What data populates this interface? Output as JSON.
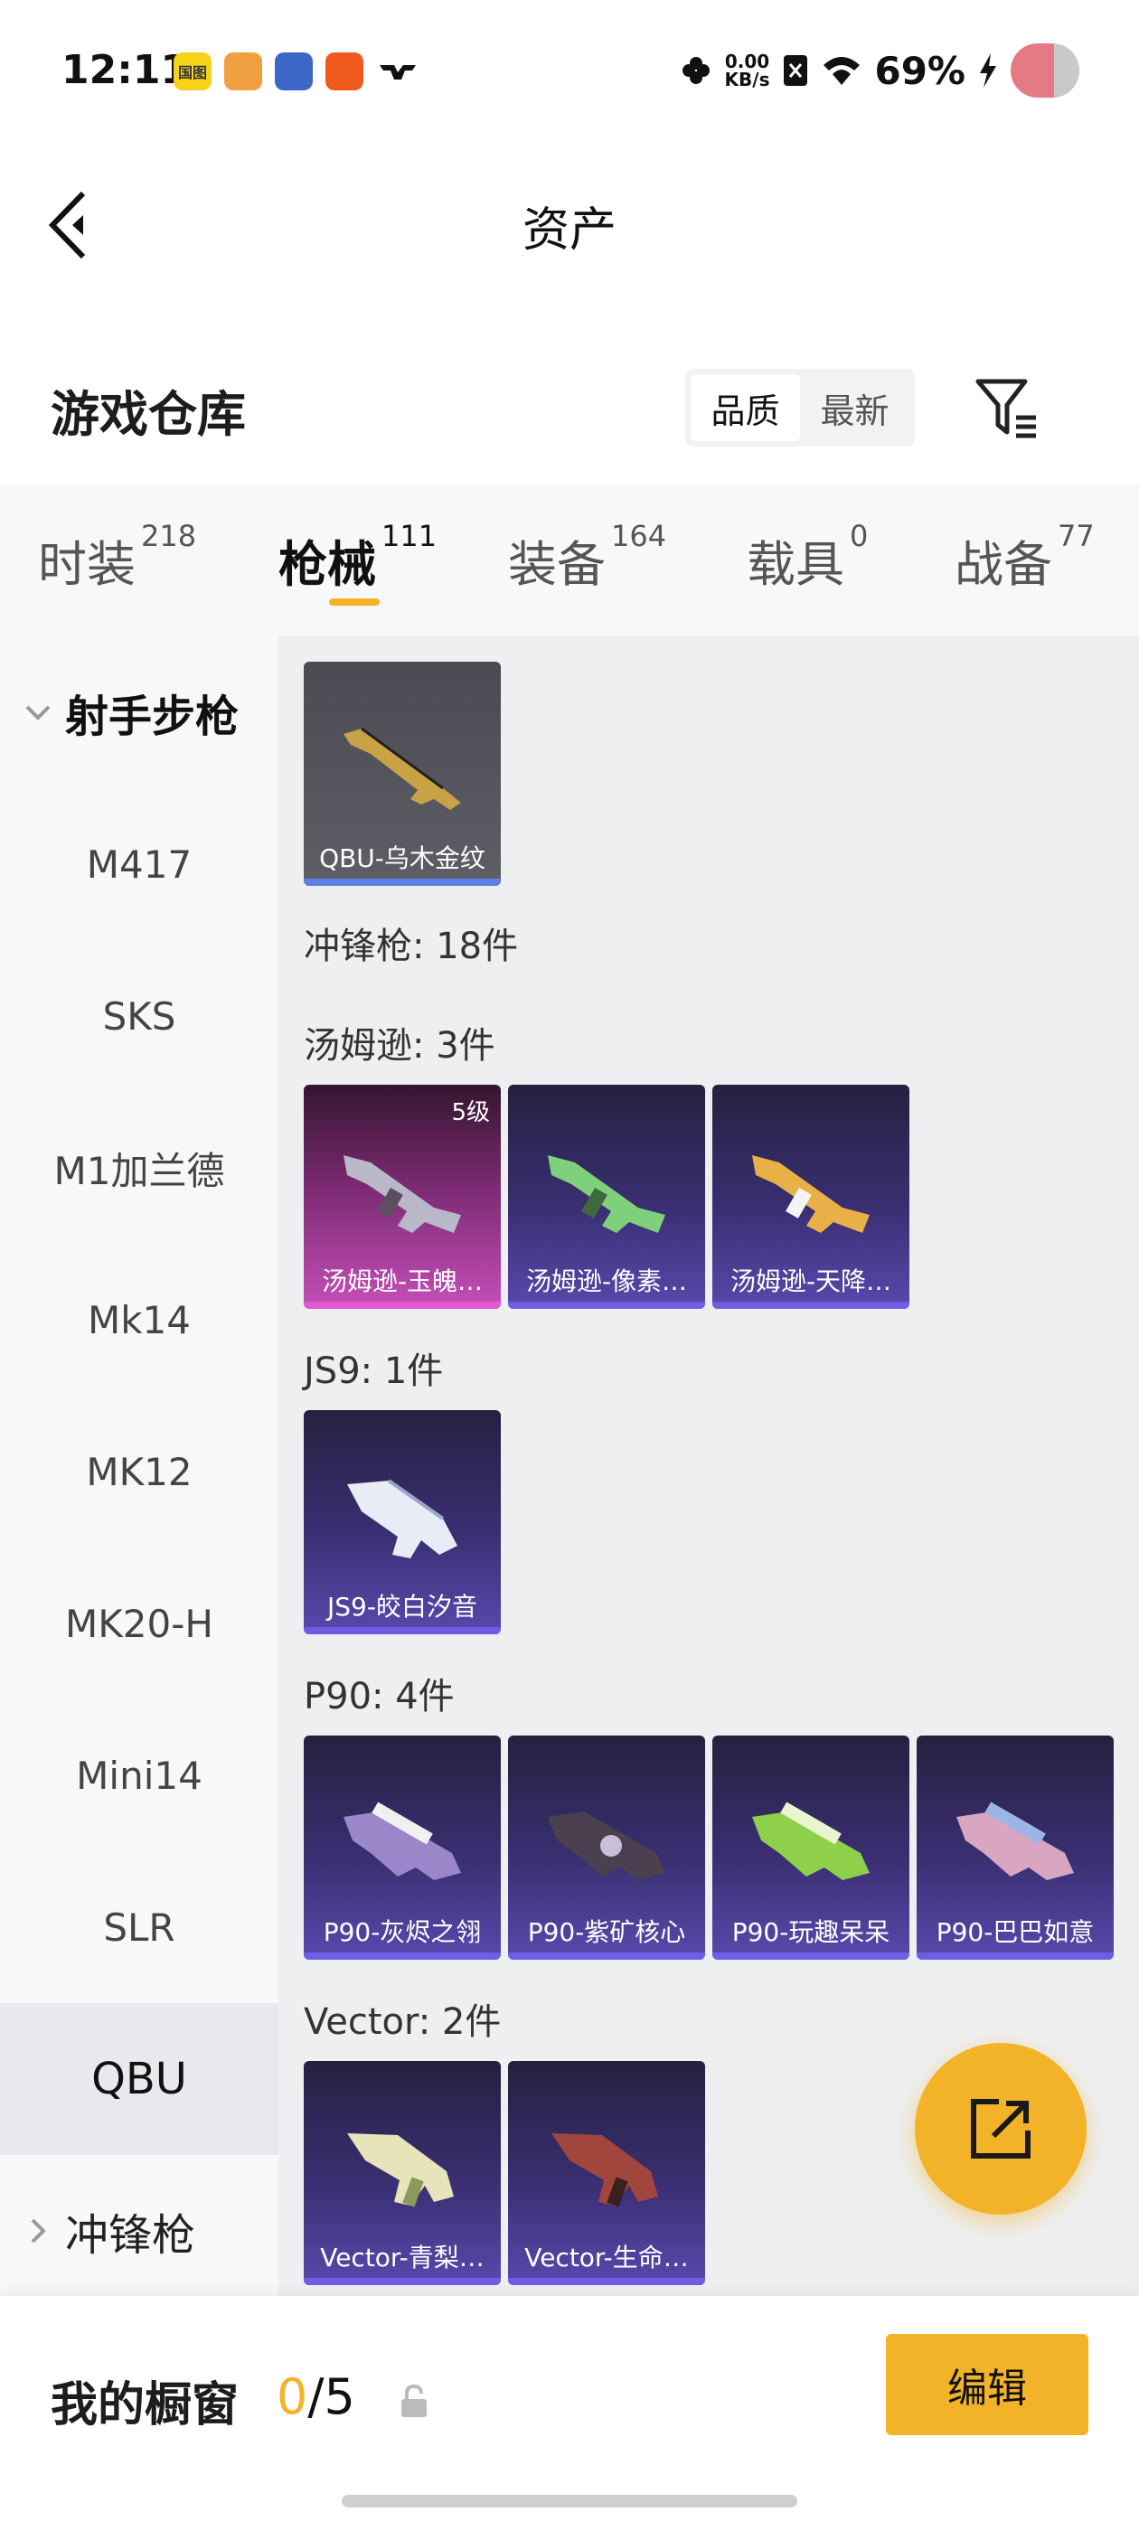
{
  "status": {
    "time": "12:11",
    "net_speed": "0.00",
    "net_unit": "KB/s",
    "battery": "69%",
    "apps": [
      {
        "name": "app-icon-1",
        "color": "#f6d21a",
        "label": "国图"
      },
      {
        "name": "app-icon-2",
        "color": "#f0a040",
        "label": ""
      },
      {
        "name": "app-icon-3",
        "color": "#3a67c8",
        "label": ""
      },
      {
        "name": "app-icon-4",
        "color": "#f05a1e",
        "label": ""
      }
    ]
  },
  "header": {
    "title": "资产"
  },
  "warehouse": {
    "title": "游戏仓库",
    "sort": [
      {
        "label": "品质",
        "active": true
      },
      {
        "label": "最新",
        "active": false
      }
    ]
  },
  "tabs": [
    {
      "label": "时装",
      "count": "218"
    },
    {
      "label": "枪械",
      "count": "111"
    },
    {
      "label": "装备",
      "count": "164"
    },
    {
      "label": "载具",
      "count": "0"
    },
    {
      "label": "战备",
      "count": "77"
    }
  ],
  "sidebar": {
    "group_open": "射手步枪",
    "items": [
      "M417",
      "SKS",
      "M1加兰德",
      "Mk14",
      "MK12",
      "MK20-H",
      "Mini14",
      "SLR",
      "QBU"
    ],
    "selected": "QBU",
    "group_collapsed": "冲锋枪"
  },
  "content": {
    "top_card": {
      "name": "QBU-乌木金纹",
      "color": "#c9a246"
    },
    "section_smg": "冲锋枪: 18件",
    "groups": [
      {
        "label": "汤姆逊: 3件",
        "cards": [
          {
            "name": "汤姆逊-玉魄…",
            "level": "5级",
            "color": "#b8b8c8"
          },
          {
            "name": "汤姆逊-像素…",
            "color": "#7fd07a"
          },
          {
            "name": "汤姆逊-天降…",
            "color": "#e8b046"
          }
        ]
      },
      {
        "label": "JS9: 1件",
        "cards": [
          {
            "name": "JS9-皎白汐音",
            "color": "#e8ecf6"
          }
        ]
      },
      {
        "label": "P90: 4件",
        "cards": [
          {
            "name": "P90-灰烬之翎",
            "color": "#9a86c8"
          },
          {
            "name": "P90-紫矿核心",
            "color": "#4a4050"
          },
          {
            "name": "P90-玩趣呆呆",
            "color": "#8ed04a"
          },
          {
            "name": "P90-巴巴如意",
            "color": "#d8a6c0"
          }
        ]
      },
      {
        "label": "Vector: 2件",
        "cards": [
          {
            "name": "Vector-青梨…",
            "color": "#e6e4b8"
          },
          {
            "name": "Vector-生命…",
            "color": "#a0463c"
          }
        ]
      }
    ]
  },
  "showcase": {
    "title": "我的橱窗",
    "current": "0",
    "total": "/5",
    "edit_label": "编辑"
  }
}
